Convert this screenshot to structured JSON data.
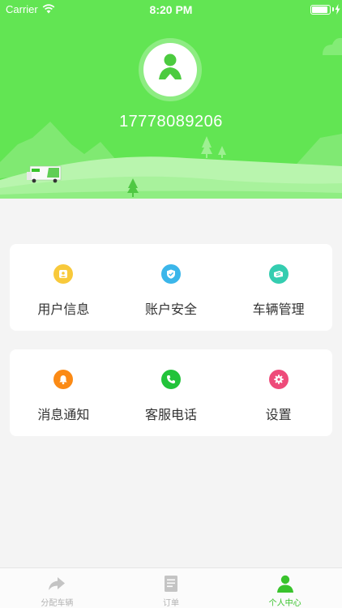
{
  "status_bar": {
    "carrier": "Carrier",
    "time": "8:20 PM",
    "battery_level": 0.9
  },
  "profile": {
    "phone": "17778089206",
    "avatar_icon": "user-icon"
  },
  "colors": {
    "hero_green": "#62e553",
    "active_tab": "#39c32c"
  },
  "menu_card_1": [
    {
      "label": "用户信息",
      "icon": "user-info-icon",
      "color": "#f8c93b"
    },
    {
      "label": "账户安全",
      "icon": "shield-icon",
      "color": "#3bb6ea"
    },
    {
      "label": "车辆管理",
      "icon": "truck-icon",
      "color": "#34cdb0"
    }
  ],
  "menu_card_2": [
    {
      "label": "消息通知",
      "icon": "bell-icon",
      "color": "#fb8a15"
    },
    {
      "label": "客服电话",
      "icon": "phone-icon",
      "color": "#22c33a"
    },
    {
      "label": "设置",
      "icon": "gear-icon",
      "color": "#ee4b7a"
    }
  ],
  "tabs": [
    {
      "label": "分配车辆",
      "icon": "share-arrow-icon",
      "active": false
    },
    {
      "label": "订单",
      "icon": "document-icon",
      "active": false
    },
    {
      "label": "个人中心",
      "icon": "person-icon",
      "active": true
    }
  ]
}
